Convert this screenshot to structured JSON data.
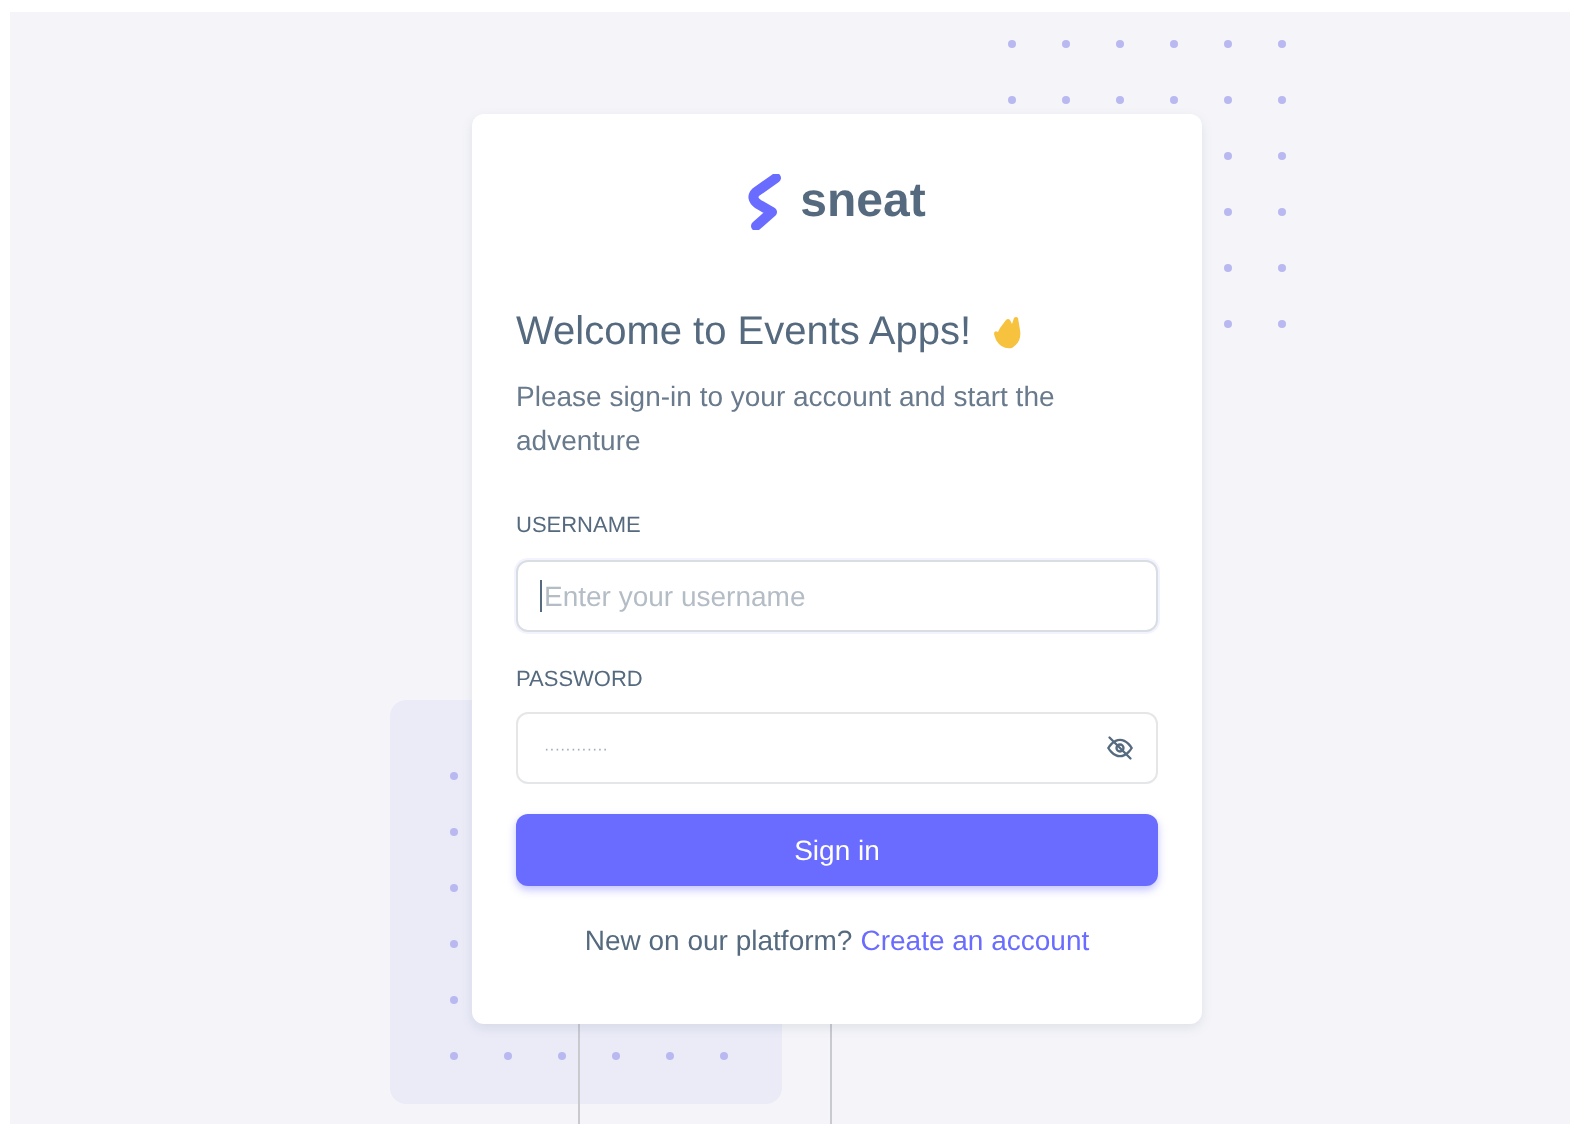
{
  "brand": {
    "name": "sneat"
  },
  "heading": {
    "title": "Welcome to Events Apps!",
    "subtitle": "Please sign-in to your account and start the adventure"
  },
  "fields": [
    {
      "kind": "text",
      "label": "USERNAME",
      "placeholder": "Enter your username",
      "focused": true
    },
    {
      "kind": "password",
      "label": "PASSWORD",
      "placeholder": "············",
      "focused": false
    }
  ],
  "submit": {
    "label": "Sign in"
  },
  "footer": {
    "prompt": "New on our platform?",
    "link": "Create an account"
  }
}
